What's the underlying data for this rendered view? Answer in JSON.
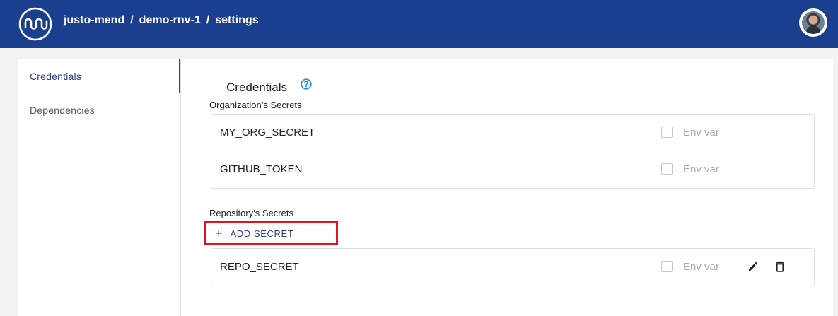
{
  "header": {
    "breadcrumb": [
      "justo-mend",
      "demo-rnv-1",
      "settings"
    ],
    "separator": "/",
    "logo_icon": "wave-logo-icon",
    "avatar_icon": "user-avatar"
  },
  "sidebar": {
    "items": [
      {
        "label": "Credentials",
        "active": true
      },
      {
        "label": "Dependencies",
        "active": false
      }
    ]
  },
  "main": {
    "title": "Credentials",
    "help_icon": "help-circle-icon",
    "org_section": {
      "label": "Organization’s Secrets",
      "secrets": [
        {
          "name": "MY_ORG_SECRET",
          "env_label": "Env var",
          "env_checked": false
        },
        {
          "name": "GITHUB_TOKEN",
          "env_label": "Env var",
          "env_checked": false
        }
      ]
    },
    "repo_section": {
      "label": "Repository’s Secrets",
      "add_button_label": "ADD SECRET",
      "add_button_icon": "+",
      "secrets": [
        {
          "name": "REPO_SECRET",
          "env_label": "Env var",
          "env_checked": false
        }
      ]
    }
  },
  "colors": {
    "header_bg": "#1b3f8f",
    "accent": "#2c3e91",
    "highlight_border": "#e0141e"
  }
}
